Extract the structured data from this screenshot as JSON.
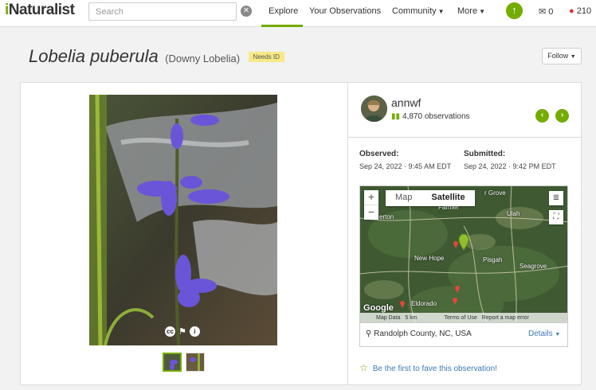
{
  "nav": {
    "logo_i": "i",
    "logo_rest": "Naturalist",
    "search_placeholder": "Search",
    "clear": "✕",
    "explore": "Explore",
    "your_observations": "Your Observations",
    "community": "Community",
    "more": "More",
    "messages_count": "0",
    "notifications_count": "210"
  },
  "title": {
    "scientific_name": "Lobelia puberula",
    "common_name": "(Downy Lobelia)",
    "quality_badge": "Needs ID",
    "follow_label": "Follow"
  },
  "observer": {
    "username": "annwf",
    "observation_count": "4,870 observations"
  },
  "dates": {
    "observed_label": "Observed:",
    "observed_value": "Sep 24, 2022 · 9:45 AM EDT",
    "submitted_label": "Submitted:",
    "submitted_value": "Sep 24, 2022 · 9:42 PM EDT"
  },
  "map": {
    "map_tab": "Map",
    "satellite_tab": "Satellite",
    "zoom_in": "+",
    "zoom_out": "−",
    "google": "Google",
    "map_data": "Map Data",
    "scale": "5 km",
    "terms": "Terms of Use",
    "report": "Report a map error",
    "places": {
      "new_hope": "New Hope",
      "pisgah": "Pisgah",
      "seagrove": "Seagrove",
      "eldorado": "Eldorado",
      "ulah": "Ulah",
      "farmer": "Farmer",
      "erton": "erton",
      "grove": "r Grove"
    }
  },
  "location": {
    "place": "Randolph County, NC, USA",
    "details_label": "Details"
  },
  "fave": {
    "label": "Be the first to fave this observation!"
  },
  "colors": {
    "brand_green": "#74ac00",
    "link_blue": "#3d7bb5",
    "badge_yellow": "#f7e986"
  }
}
